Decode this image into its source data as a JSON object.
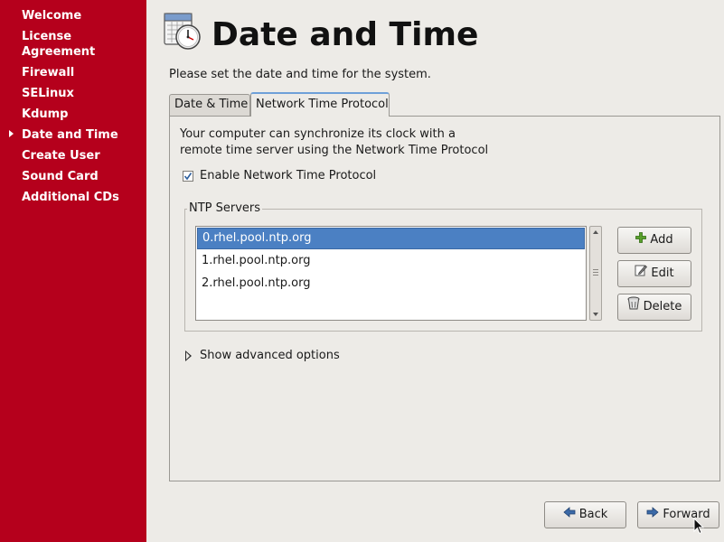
{
  "sidebar": {
    "items": [
      {
        "label": "Welcome"
      },
      {
        "label": "License Agreement"
      },
      {
        "label": "Firewall"
      },
      {
        "label": "SELinux"
      },
      {
        "label": "Kdump"
      },
      {
        "label": "Date and Time",
        "current": true
      },
      {
        "label": "Create User"
      },
      {
        "label": "Sound Card"
      },
      {
        "label": "Additional CDs"
      }
    ]
  },
  "header": {
    "title": "Date and Time",
    "subtitle": "Please set the date and time for the system.",
    "icon": "calendar-clock-icon"
  },
  "tabs": [
    {
      "label": "Date & Time",
      "active": false
    },
    {
      "label": "Network Time Protocol",
      "active": true
    }
  ],
  "ntp": {
    "description_line1": "Your computer can synchronize its clock with a",
    "description_line2": "remote time server using the Network Time Protocol",
    "enable_label": "Enable Network Time Protocol",
    "enable_checked": true,
    "servers_label": "NTP Servers",
    "servers": [
      {
        "host": "0.rhel.pool.ntp.org",
        "selected": true
      },
      {
        "host": "1.rhel.pool.ntp.org",
        "selected": false
      },
      {
        "host": "2.rhel.pool.ntp.org",
        "selected": false
      }
    ],
    "add_label": "Add",
    "edit_label": "Edit",
    "delete_label": "Delete",
    "advanced_label": "Show advanced options"
  },
  "footer": {
    "back_label": "Back",
    "forward_label": "Forward"
  },
  "colors": {
    "sidebar_bg": "#b5001c",
    "selection": "#4b80c3",
    "window_bg": "#edebe7"
  }
}
